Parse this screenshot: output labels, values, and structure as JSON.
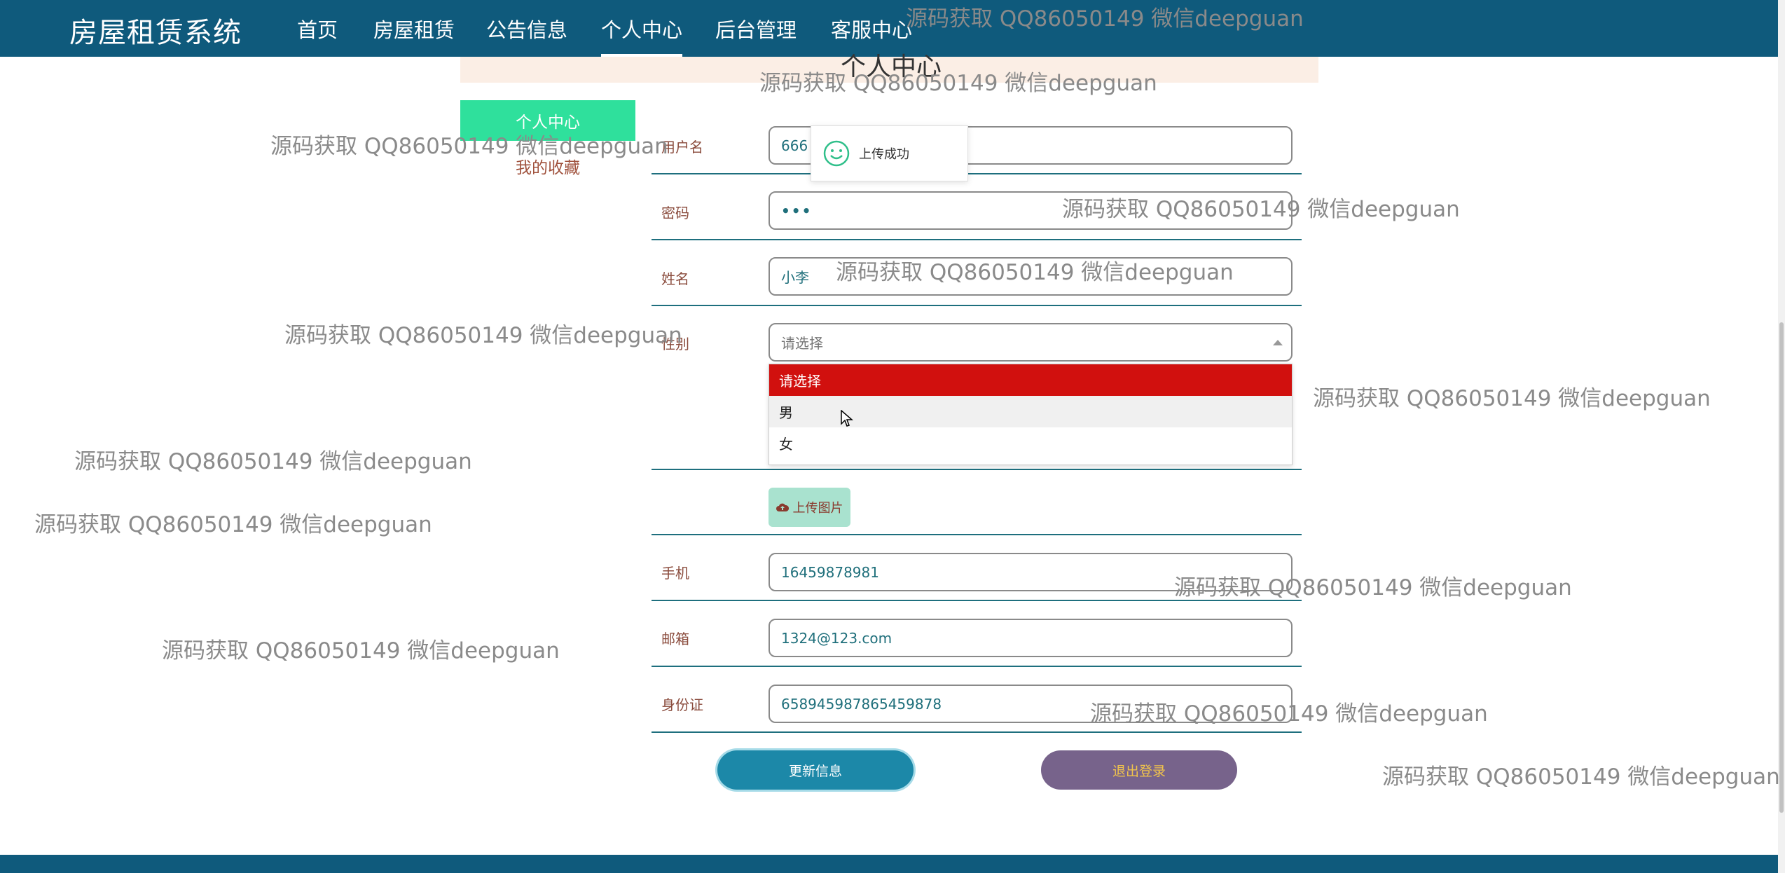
{
  "brand": "房屋租赁系统",
  "nav": [
    "首页",
    "房屋租赁",
    "公告信息",
    "个人中心",
    "后台管理",
    "客服中心"
  ],
  "page_title": "个人中心",
  "sidebar": {
    "active": "个人中心",
    "link": "我的收藏"
  },
  "form": {
    "username": {
      "label": "用户名",
      "value": "666"
    },
    "password": {
      "label": "密码",
      "value": "•••"
    },
    "name": {
      "label": "姓名",
      "value": "小李"
    },
    "gender": {
      "label": "性别",
      "value": "请选择"
    },
    "gender_options": [
      "请选择",
      "男",
      "女"
    ],
    "upload_label": "上传图片",
    "phone": {
      "label": "手机",
      "value": "16459878981"
    },
    "email": {
      "label": "邮箱",
      "value": "1324@123.com"
    },
    "idcard": {
      "label": "身份证",
      "value": "658945987865459878"
    }
  },
  "toast": "上传成功",
  "buttons": {
    "update": "更新信息",
    "logout": "退出登录"
  },
  "watermark": "源码获取 QQ86050149 微信deepguan",
  "colors": {
    "nav_bg": "#0f5a7c",
    "active_side": "#2fe09c",
    "selected_option": "#d1100e",
    "update_btn": "#1c88a8",
    "logout_btn": "#77638b"
  }
}
